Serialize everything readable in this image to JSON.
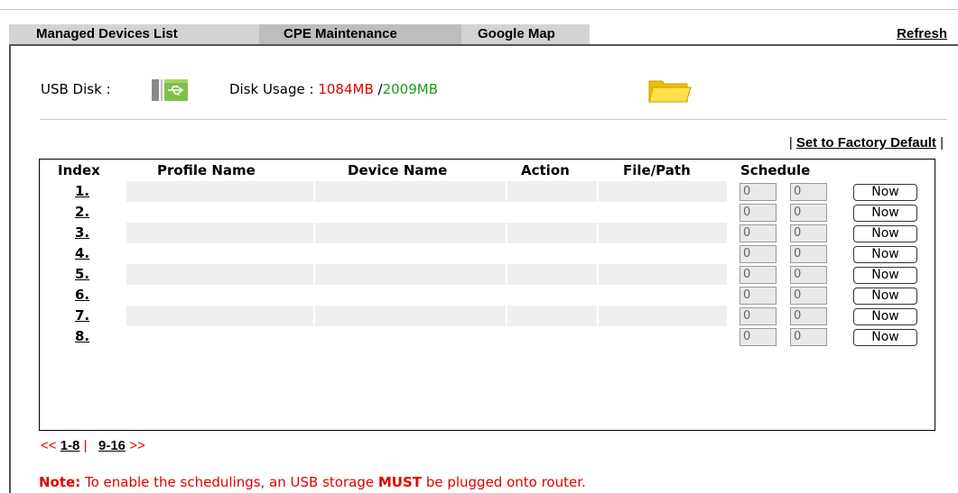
{
  "tabs": [
    {
      "label": "Managed Devices List"
    },
    {
      "label": "CPE Maintenance"
    },
    {
      "label": "Google Map"
    }
  ],
  "refresh_label": "Refresh",
  "usb": {
    "label": "USB Disk :",
    "usage_label": "Disk Usage :",
    "used": "1084MB",
    "separator": "/",
    "total": "2009MB",
    "usb_icon": "usb-connected-icon",
    "folder_icon": "folder-icon"
  },
  "factory_default": {
    "left_pipe": "|",
    "label": "Set to Factory Default",
    "right_pipe": "|"
  },
  "table": {
    "headers": {
      "index": "Index",
      "profile": "Profile Name",
      "device": "Device Name",
      "action": "Action",
      "file": "File/Path",
      "schedule": "Schedule"
    },
    "rows": [
      {
        "index": "1.",
        "s1": "0",
        "s2": "0",
        "button": "Now"
      },
      {
        "index": "2.",
        "s1": "0",
        "s2": "0",
        "button": "Now"
      },
      {
        "index": "3.",
        "s1": "0",
        "s2": "0",
        "button": "Now"
      },
      {
        "index": "4.",
        "s1": "0",
        "s2": "0",
        "button": "Now"
      },
      {
        "index": "5.",
        "s1": "0",
        "s2": "0",
        "button": "Now"
      },
      {
        "index": "6.",
        "s1": "0",
        "s2": "0",
        "button": "Now"
      },
      {
        "index": "7.",
        "s1": "0",
        "s2": "0",
        "button": "Now"
      },
      {
        "index": "8.",
        "s1": "0",
        "s2": "0",
        "button": "Now"
      }
    ]
  },
  "pager": {
    "prev": "<<",
    "page1": "1-8",
    "sep": "|",
    "page2": "9-16",
    "next": ">>"
  },
  "note": {
    "prefix": "Note:",
    "text1": "To enable the schedulings, an USB storage",
    "emph": "MUST",
    "text2": "be plugged onto router."
  },
  "colors": {
    "used": "#e00000",
    "total": "#1a9b1a",
    "note": "#e00000"
  }
}
